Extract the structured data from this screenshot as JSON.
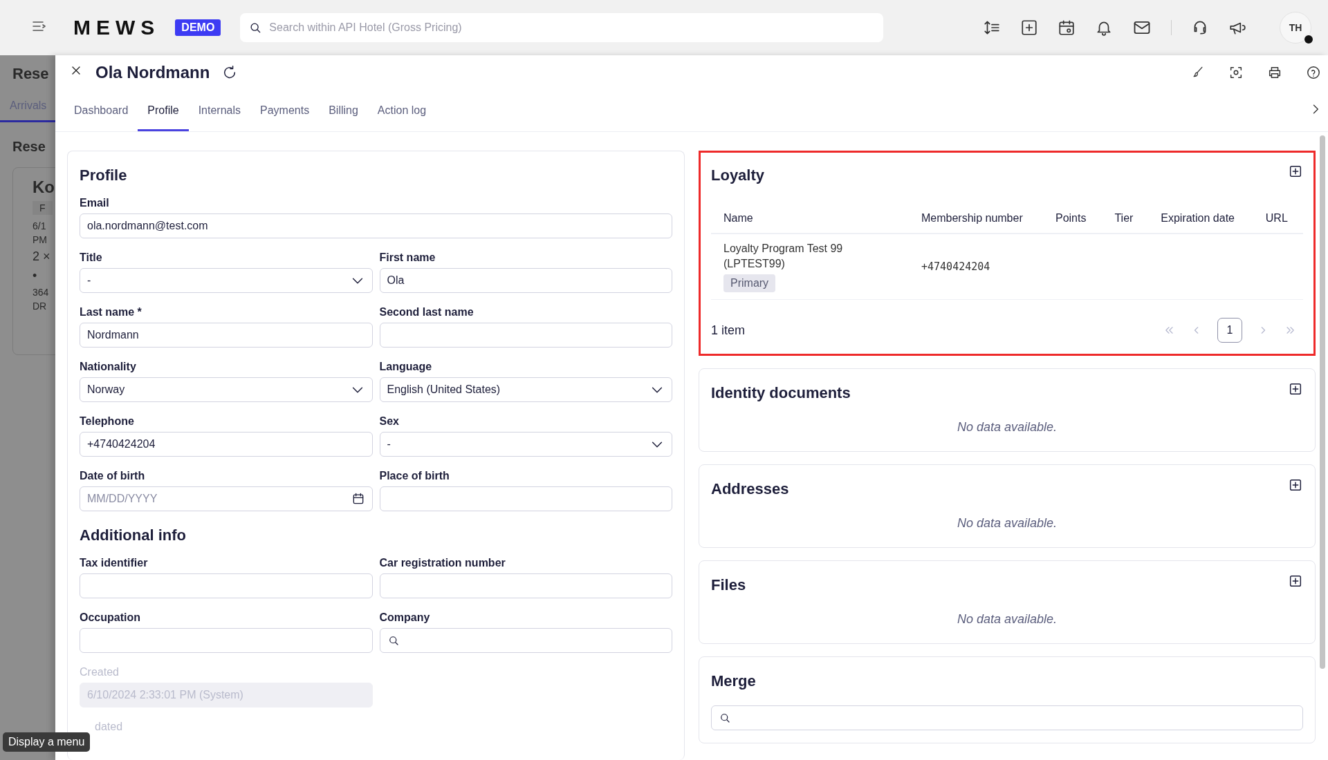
{
  "topbar": {
    "logo": "MEWS",
    "badge": "DEMO",
    "search_placeholder": "Search within API Hotel (Gross Pricing)",
    "avatar": "TH"
  },
  "background_page": {
    "items": [
      {
        "kind": "title",
        "text": "Rese"
      },
      {
        "kind": "tab",
        "text": "Arrivals"
      },
      {
        "kind": "heading",
        "text": "Rese"
      },
      {
        "kind": "card_title",
        "text": "Ko"
      },
      {
        "kind": "chip",
        "text": "F"
      },
      {
        "kind": "line",
        "text": "6/1"
      },
      {
        "kind": "line",
        "text": "PM"
      },
      {
        "kind": "big",
        "text": "2 ×"
      },
      {
        "kind": "big",
        "text": "•"
      },
      {
        "kind": "line",
        "text": "364"
      },
      {
        "kind": "line",
        "text": "DR"
      }
    ]
  },
  "drawer": {
    "title": "Ola Nordmann",
    "tabs": [
      {
        "label": "Dashboard",
        "selected": false
      },
      {
        "label": "Profile",
        "selected": true
      },
      {
        "label": "Internals",
        "selected": false
      },
      {
        "label": "Payments",
        "selected": false
      },
      {
        "label": "Billing",
        "selected": false
      },
      {
        "label": "Action log",
        "selected": false
      }
    ]
  },
  "profile_sections": [
    {
      "title": "Profile",
      "fields": [
        {
          "label": "Email",
          "kind": "text",
          "value": "ola.nordmann@test.com",
          "wide": true
        },
        {
          "label": "Title",
          "kind": "select",
          "value": "-"
        },
        {
          "label": "First name",
          "kind": "text",
          "value": "Ola"
        },
        {
          "label": "Last name *",
          "kind": "text",
          "value": "Nordmann"
        },
        {
          "label": "Second last name",
          "kind": "text"
        },
        {
          "label": "Nationality",
          "kind": "select",
          "value": "Norway"
        },
        {
          "label": "Language",
          "kind": "select",
          "value": "English (United States)"
        },
        {
          "label": "Telephone",
          "kind": "text",
          "value": "+4740424204"
        },
        {
          "label": "Sex",
          "kind": "select",
          "value": "-"
        },
        {
          "label": "Date of birth",
          "kind": "date",
          "placeholder": "MM/DD/YYYY"
        },
        {
          "label": "Place of birth",
          "kind": "text"
        }
      ]
    },
    {
      "title": "Additional info",
      "fields": [
        {
          "label": "Tax identifier",
          "kind": "text"
        },
        {
          "label": "Car registration number",
          "kind": "text"
        },
        {
          "label": "Occupation",
          "kind": "text"
        },
        {
          "label": "Company",
          "kind": "search"
        },
        {
          "label": "Created",
          "kind": "text",
          "value": "6/10/2024 2:33:01 PM (System)",
          "disabled": true
        },
        {
          "label": "dated",
          "kind": "label_only",
          "disabled": true,
          "wide": true
        }
      ]
    }
  ],
  "loyalty": {
    "title": "Loyalty",
    "highlighted": true,
    "columns": [
      "Name",
      "Membership number",
      "Points",
      "Tier",
      "Expiration date",
      "URL"
    ],
    "rows": [
      {
        "name": "Loyalty Program Test 99 (LPTEST99)",
        "tag": "Primary",
        "membership_number": "+4740424204"
      }
    ],
    "count": "1 item",
    "pages": [
      {
        "label": "1",
        "selected": true
      }
    ]
  },
  "cards": [
    {
      "title": "Identity documents",
      "empty_text": "No data available."
    },
    {
      "title": "Addresses",
      "empty_text": "No data available."
    },
    {
      "title": "Files",
      "empty_text": "No data available."
    }
  ],
  "merge": {
    "title": "Merge"
  },
  "tooltip": "Display a menu"
}
